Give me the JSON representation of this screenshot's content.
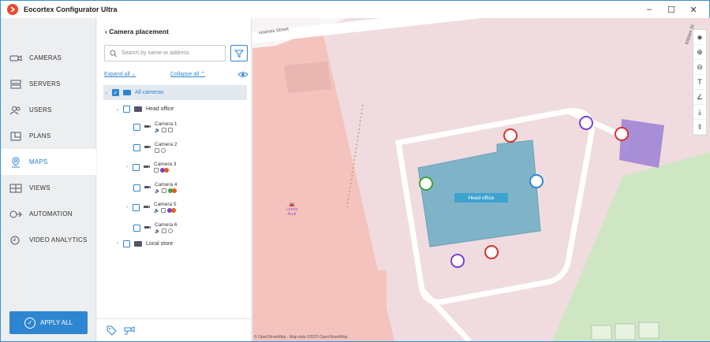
{
  "app": {
    "title": "Eocortex Configurator Ultra"
  },
  "window_controls": {
    "minimize": "–",
    "maximize": "☐",
    "close": "✕"
  },
  "sidebar": {
    "items": [
      {
        "label": "CAMERAS",
        "icon": "camera-icon"
      },
      {
        "label": "SERVERS",
        "icon": "server-icon"
      },
      {
        "label": "USERS",
        "icon": "users-icon"
      },
      {
        "label": "PLANS",
        "icon": "plans-icon"
      },
      {
        "label": "MAPS",
        "icon": "map-pin-icon",
        "active": true
      },
      {
        "label": "VIEWS",
        "icon": "views-icon"
      },
      {
        "label": "AUTOMATION",
        "icon": "automation-icon"
      },
      {
        "label": "VIDEO ANALYTICS",
        "icon": "analytics-icon"
      }
    ],
    "apply_label": "APPLY ALL"
  },
  "panel": {
    "title": "Camera placement",
    "search_placeholder": "Search by name or address",
    "expand_all": "Expand all",
    "collapse_all": "Collapse all",
    "tree": {
      "root": "All cameras",
      "groups": [
        {
          "name": "Head office",
          "cameras": [
            {
              "name": "Camera 1",
              "indicators": [
                "audio",
                "ptz",
                "record"
              ]
            },
            {
              "name": "Camera 2",
              "indicators": [
                "record",
                "info"
              ]
            },
            {
              "name": "Camera 3",
              "indicators": [
                "record",
                "analytics"
              ]
            },
            {
              "name": "Camera 4",
              "indicators": [
                "audio",
                "record",
                "analytics"
              ]
            },
            {
              "name": "Camera 5",
              "indicators": [
                "audio",
                "record",
                "analytics"
              ]
            },
            {
              "name": "Camera 6",
              "indicators": [
                "audio",
                "record",
                "info"
              ]
            }
          ]
        },
        {
          "name": "Local store",
          "cameras": []
        }
      ]
    }
  },
  "map": {
    "street_1": "Holmes Street",
    "street_2": "Kildare St",
    "building_label": "Head office",
    "poi": "Leeds Audi",
    "attribution": "© OpenStreetMap - Map data ©2023 OpenStreetMap",
    "tools": [
      "layers-icon",
      "zoom-in-icon",
      "zoom-out-icon",
      "text-icon",
      "angle-icon",
      "download-icon",
      "export-icon"
    ]
  },
  "colors": {
    "accent": "#2f86d0",
    "map_bg": "#f0dcdf",
    "building": "#7fb3c8"
  }
}
